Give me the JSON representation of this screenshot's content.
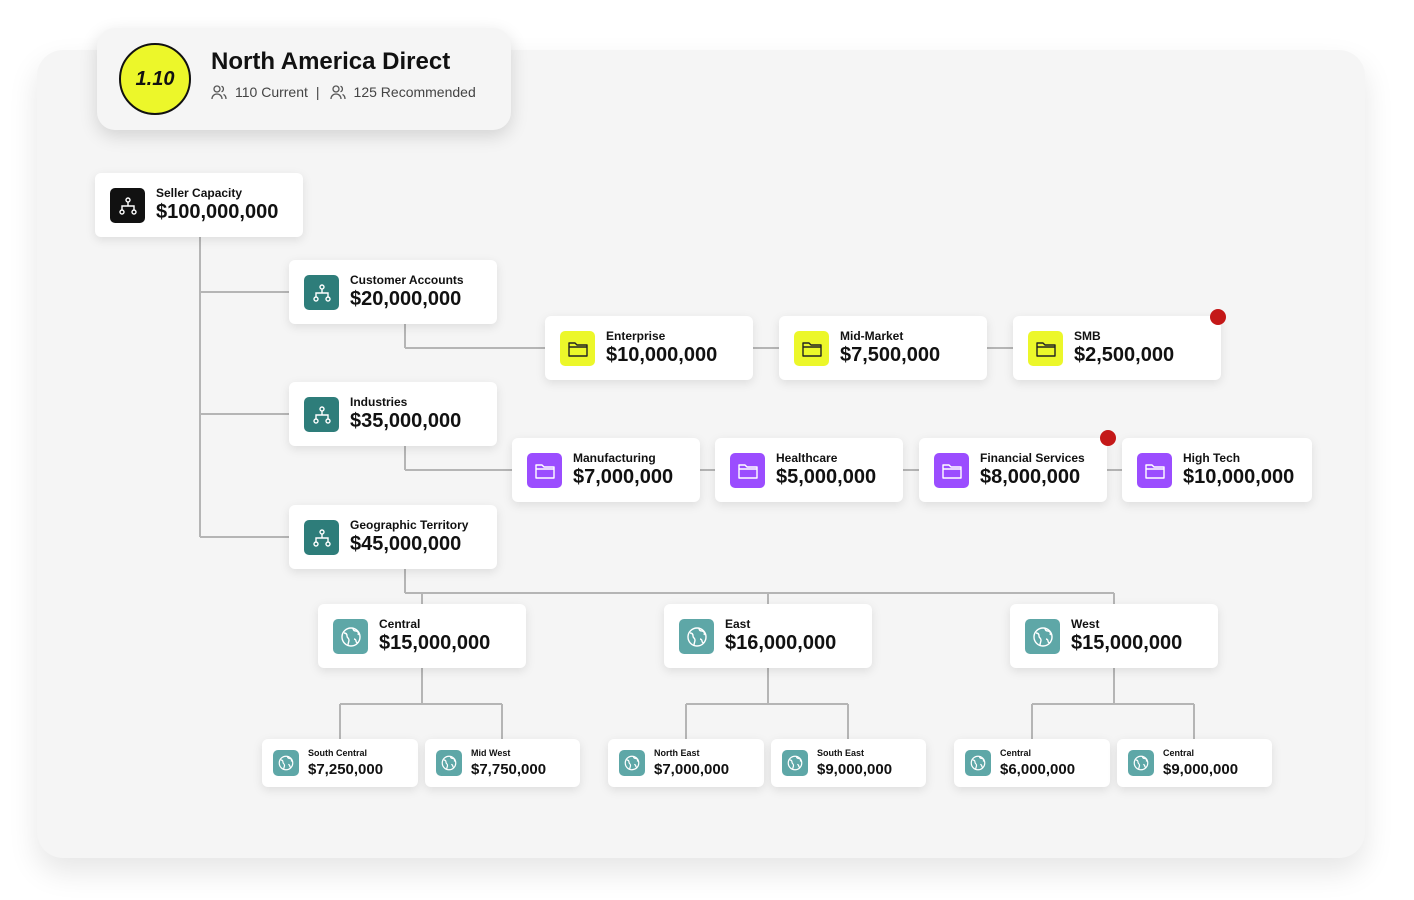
{
  "header": {
    "version": "1.10",
    "title": "North America Direct",
    "current": "110 Current",
    "separator": "|",
    "recommended": "125 Recommended"
  },
  "colors": {
    "badge": "#ecf72a",
    "hierarchy_icon_dark": "#111111",
    "hierarchy_icon_teal": "#2e7d7a",
    "folder_yellow": "#ecf72a",
    "folder_purple": "#9b4dff",
    "globe_teal": "#5ea7a7",
    "alert_dot": "#c41818"
  },
  "nodes": {
    "root": {
      "label": "Seller Capacity",
      "value": "$100,000,000",
      "icon": "hierarchy-icon"
    },
    "customer_accounts": {
      "label": "Customer Accounts",
      "value": "$20,000,000",
      "icon": "hierarchy-icon"
    },
    "enterprise": {
      "label": "Enterprise",
      "value": "$10,000,000",
      "icon": "folder-icon"
    },
    "mid_market": {
      "label": "Mid-Market",
      "value": "$7,500,000",
      "icon": "folder-icon"
    },
    "smb": {
      "label": "SMB",
      "value": "$2,500,000",
      "icon": "folder-icon"
    },
    "industries": {
      "label": "Industries",
      "value": "$35,000,000",
      "icon": "hierarchy-icon"
    },
    "manufacturing": {
      "label": "Manufacturing",
      "value": "$7,000,000",
      "icon": "folder-icon"
    },
    "healthcare": {
      "label": "Healthcare",
      "value": "$5,000,000",
      "icon": "folder-icon"
    },
    "financial_services": {
      "label": "Financial Services",
      "value": "$8,000,000",
      "icon": "folder-icon"
    },
    "high_tech": {
      "label": "High Tech",
      "value": "$10,000,000",
      "icon": "folder-icon"
    },
    "geographic_territory": {
      "label": "Geographic Territory",
      "value": "$45,000,000",
      "icon": "hierarchy-icon"
    },
    "central": {
      "label": "Central",
      "value": "$15,000,000",
      "icon": "globe-icon"
    },
    "east": {
      "label": "East",
      "value": "$16,000,000",
      "icon": "globe-icon"
    },
    "west": {
      "label": "West",
      "value": "$15,000,000",
      "icon": "globe-icon"
    },
    "south_central": {
      "label": "South Central",
      "value": "$7,250,000",
      "icon": "globe-icon"
    },
    "mid_west": {
      "label": "Mid West",
      "value": "$7,750,000",
      "icon": "globe-icon"
    },
    "north_east": {
      "label": "North East",
      "value": "$7,000,000",
      "icon": "globe-icon"
    },
    "south_east": {
      "label": "South East",
      "value": "$9,000,000",
      "icon": "globe-icon"
    },
    "west_central": {
      "label": "Central",
      "value": "$6,000,000",
      "icon": "globe-icon"
    },
    "west_central_2": {
      "label": "Central",
      "value": "$9,000,000",
      "icon": "globe-icon"
    }
  }
}
